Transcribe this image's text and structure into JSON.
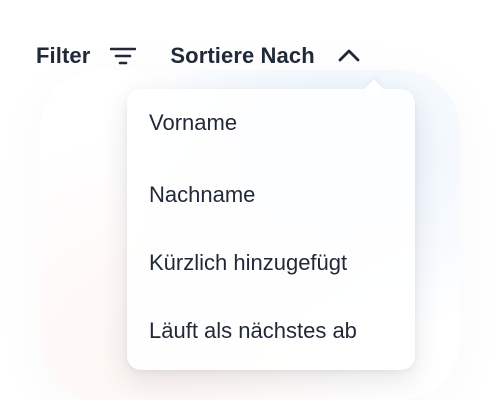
{
  "toolbar": {
    "filter_label": "Filter",
    "filter_icon": "filter-lines-icon",
    "sort_label": "Sortiere Nach",
    "sort_icon": "chevron-up-icon"
  },
  "sort_menu": {
    "items": [
      {
        "label": "Vorname"
      },
      {
        "label": "Nachname"
      },
      {
        "label": "Kürzlich hinzugefügt"
      },
      {
        "label": "Läuft als nächstes ab"
      }
    ]
  },
  "colors": {
    "text": "#1f2937",
    "background": "#ffffff",
    "menu_background": "#ffffff"
  }
}
